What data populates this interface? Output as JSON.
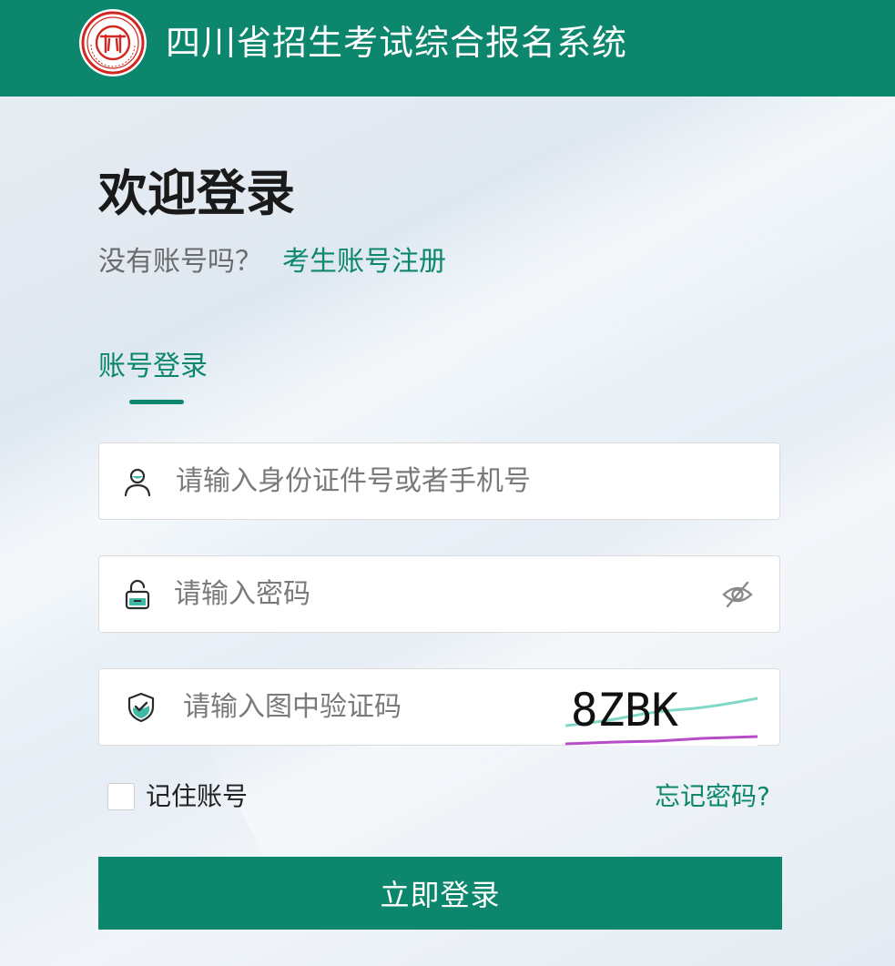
{
  "header": {
    "title": "四川省招生考试综合报名系统",
    "logo_icon": "sichuan-exam-seal-logo"
  },
  "welcome": {
    "title": "欢迎登录",
    "no_account_text": "没有账号吗？",
    "register_link": "考生账号注册"
  },
  "tabs": [
    {
      "label": "账号登录",
      "active": true
    }
  ],
  "form": {
    "account": {
      "placeholder": "请输入身份证件号或者手机号",
      "value": "",
      "icon": "user-icon"
    },
    "password": {
      "placeholder": "请输入密码",
      "value": "",
      "icon": "lock-icon",
      "toggle_icon": "eye-off-icon"
    },
    "captcha": {
      "placeholder": "请输入图中验证码",
      "value": "",
      "icon": "shield-check-icon",
      "image_text": "8ZBK"
    },
    "remember_label": "记住账号",
    "remember_checked": false,
    "forgot_label": "忘记密码?",
    "submit_label": "立即登录"
  },
  "colors": {
    "brand": "#0c876d",
    "title_text": "#1a1a1a",
    "muted_text": "#6b6b6b"
  }
}
